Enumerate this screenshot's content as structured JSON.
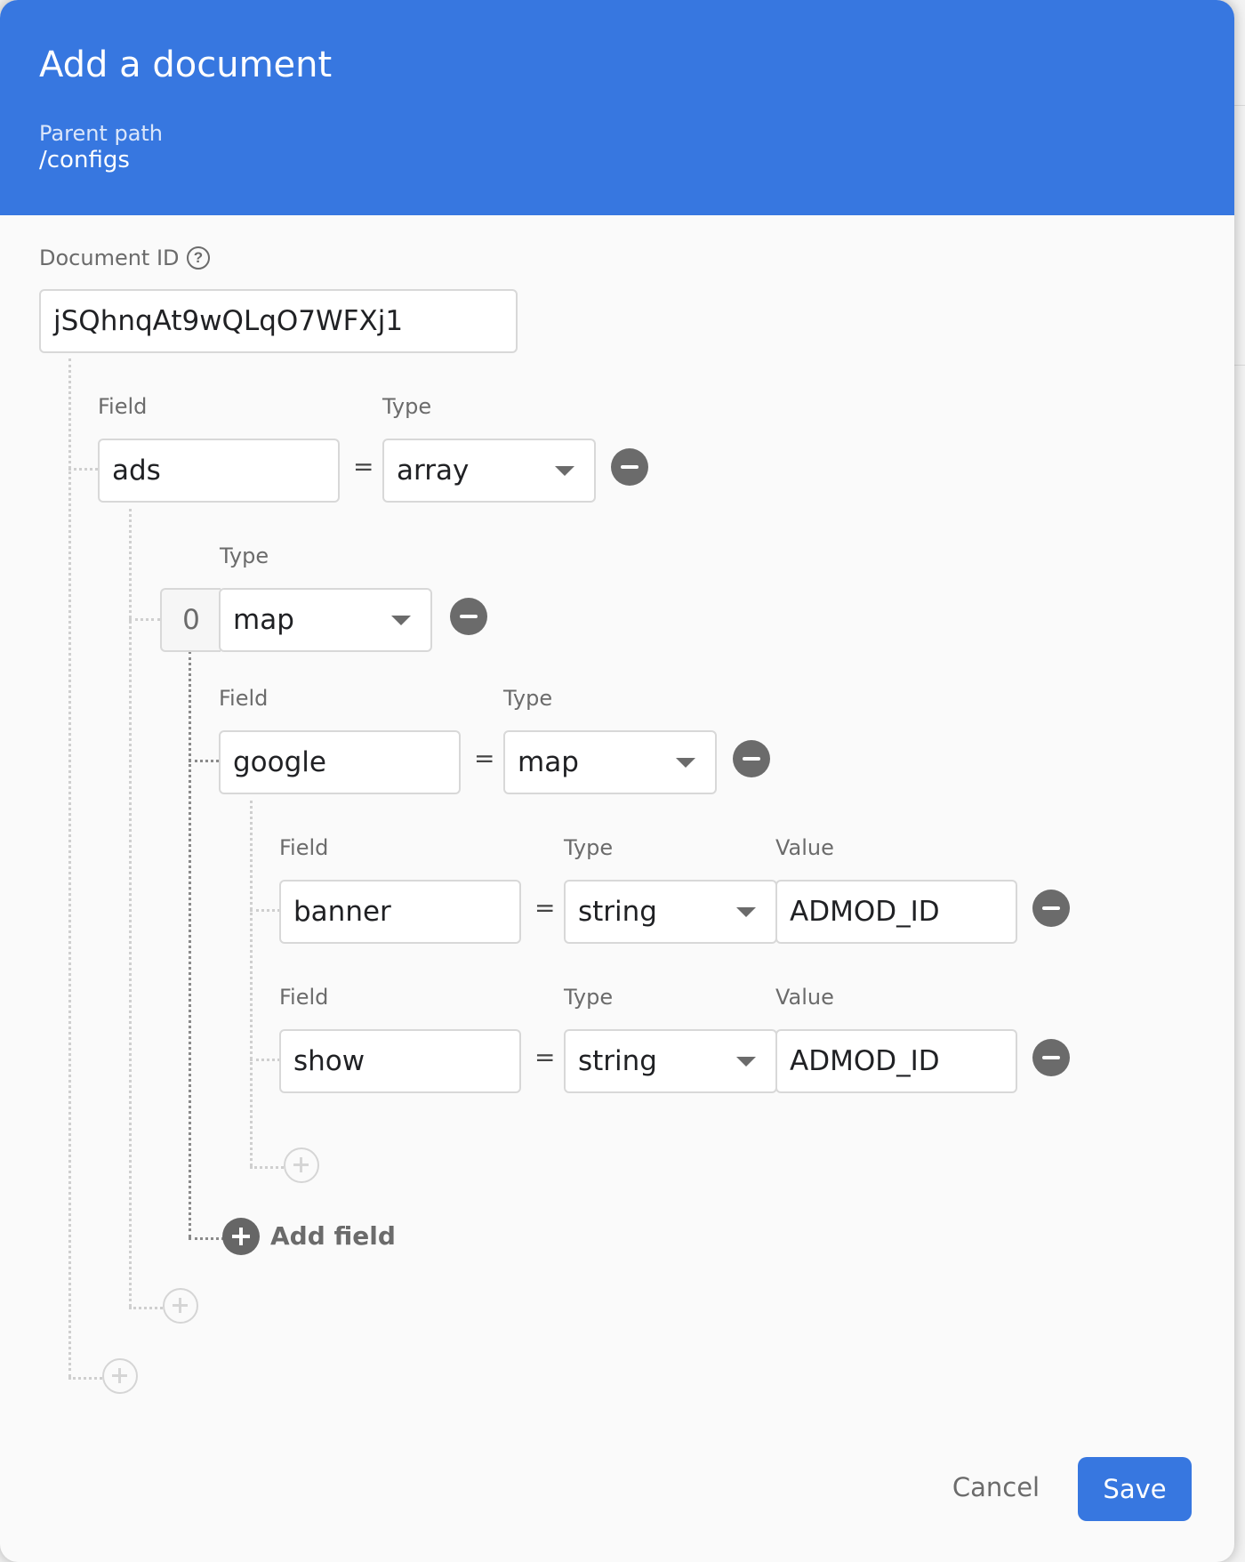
{
  "dialog": {
    "title": "Add a document"
  },
  "parent": {
    "label": "Parent path",
    "path": "/configs"
  },
  "document": {
    "id_label": "Document ID",
    "id_value": "jSQhnqAt9wQLqO7WFXj1"
  },
  "labels": {
    "field": "Field",
    "type": "Type",
    "value": "Value"
  },
  "fields": {
    "ads": {
      "name": "ads",
      "type": "array"
    },
    "item0": {
      "index": "0",
      "type": "map"
    },
    "google": {
      "name": "google",
      "type": "map"
    },
    "banner": {
      "name": "banner",
      "type": "string",
      "value": "ADMOD_ID"
    },
    "show": {
      "name": "show",
      "type": "string",
      "value": "ADMOD_ID"
    }
  },
  "equals": "=",
  "actions": {
    "add_field": "Add field",
    "cancel": "Cancel",
    "save": "Save"
  },
  "colors": {
    "header": "#3777e0",
    "primary": "#3777e0",
    "muted": "#6b6b6b"
  }
}
